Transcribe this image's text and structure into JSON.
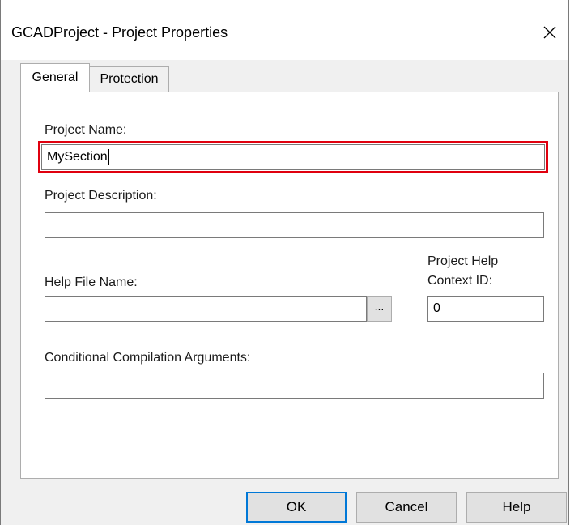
{
  "window": {
    "title": "GCADProject - Project Properties",
    "close_icon": "close-icon"
  },
  "tabs": [
    {
      "label": "General",
      "selected": true
    },
    {
      "label": "Protection",
      "selected": false
    }
  ],
  "fields": {
    "project_name": {
      "label": "Project Name:",
      "value": "MySection"
    },
    "project_description": {
      "label": "Project Description:",
      "value": ""
    },
    "help_file_name": {
      "label": "Help File Name:",
      "value": "",
      "browse_label": "..."
    },
    "help_context_id": {
      "label_line1": "Project Help",
      "label_line2": "Context ID:",
      "value": "0"
    },
    "conditional_compilation": {
      "label": "Conditional Compilation Arguments:",
      "value": ""
    }
  },
  "buttons": {
    "ok": "OK",
    "cancel": "Cancel",
    "help": "Help"
  },
  "colors": {
    "highlight": "#e0000f",
    "default_button_border": "#0078d7",
    "dialog_background": "#f0f0f0"
  }
}
